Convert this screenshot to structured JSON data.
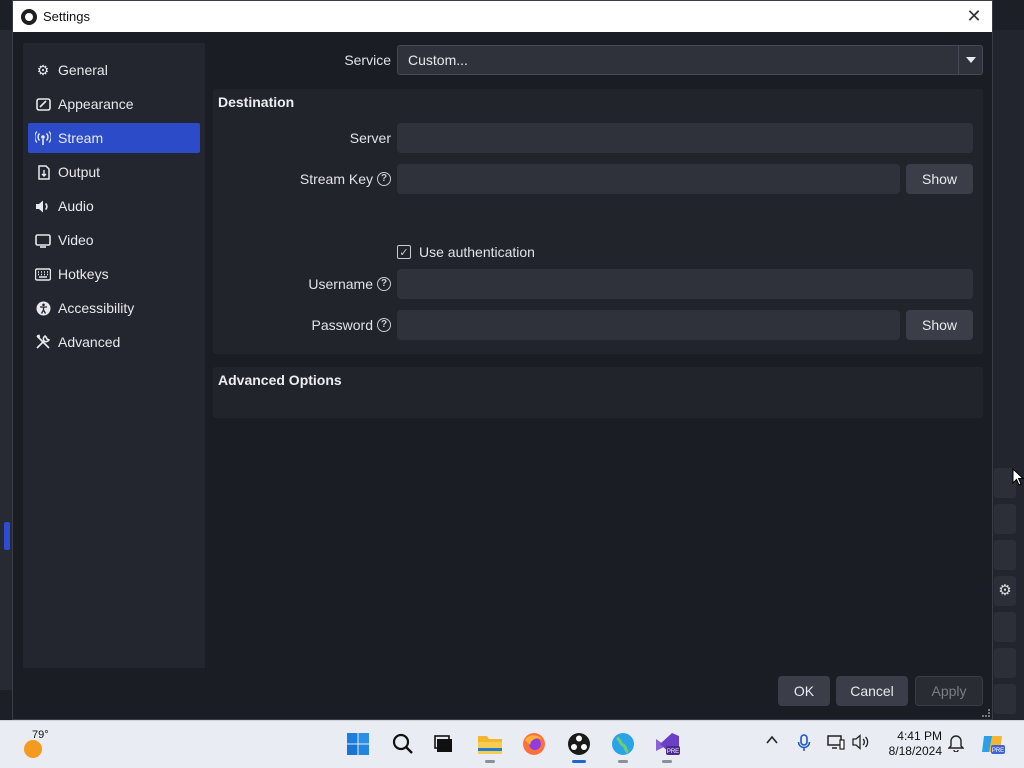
{
  "window": {
    "title": "Settings",
    "close_glyph": "✕"
  },
  "sidebar": {
    "items": [
      {
        "label": "General",
        "icon": "gear-icon"
      },
      {
        "label": "Appearance",
        "icon": "appearance-icon"
      },
      {
        "label": "Stream",
        "icon": "broadcast-icon",
        "active": true
      },
      {
        "label": "Output",
        "icon": "output-icon"
      },
      {
        "label": "Audio",
        "icon": "speaker-icon"
      },
      {
        "label": "Video",
        "icon": "monitor-icon"
      },
      {
        "label": "Hotkeys",
        "icon": "keyboard-icon"
      },
      {
        "label": "Accessibility",
        "icon": "accessibility-icon"
      },
      {
        "label": "Advanced",
        "icon": "tools-icon"
      }
    ]
  },
  "stream": {
    "service_label": "Service",
    "service_value": "Custom...",
    "destination_title": "Destination",
    "server_label": "Server",
    "server_value": "",
    "stream_key_label": "Stream Key",
    "stream_key_value": "",
    "show_label": "Show",
    "use_auth_label": "Use authentication",
    "use_auth_checked": true,
    "username_label": "Username",
    "username_value": "",
    "password_label": "Password",
    "password_value": "",
    "advanced_options_title": "Advanced Options"
  },
  "footer": {
    "ok": "OK",
    "cancel": "Cancel",
    "apply": "Apply"
  },
  "taskbar": {
    "temperature": "79°",
    "time": "4:41 PM",
    "date": "8/18/2024",
    "apps": [
      "windows-start-icon",
      "search-icon",
      "task-view-icon",
      "file-explorer-icon",
      "firefox-icon",
      "obs-icon",
      "globe-app-icon",
      "visual-studio-preview-icon"
    ]
  },
  "colors": {
    "accent": "#2b4bc8",
    "dialog_bg": "#1b1d24",
    "panel_bg": "#24262f",
    "field_bg": "#2f323b"
  }
}
